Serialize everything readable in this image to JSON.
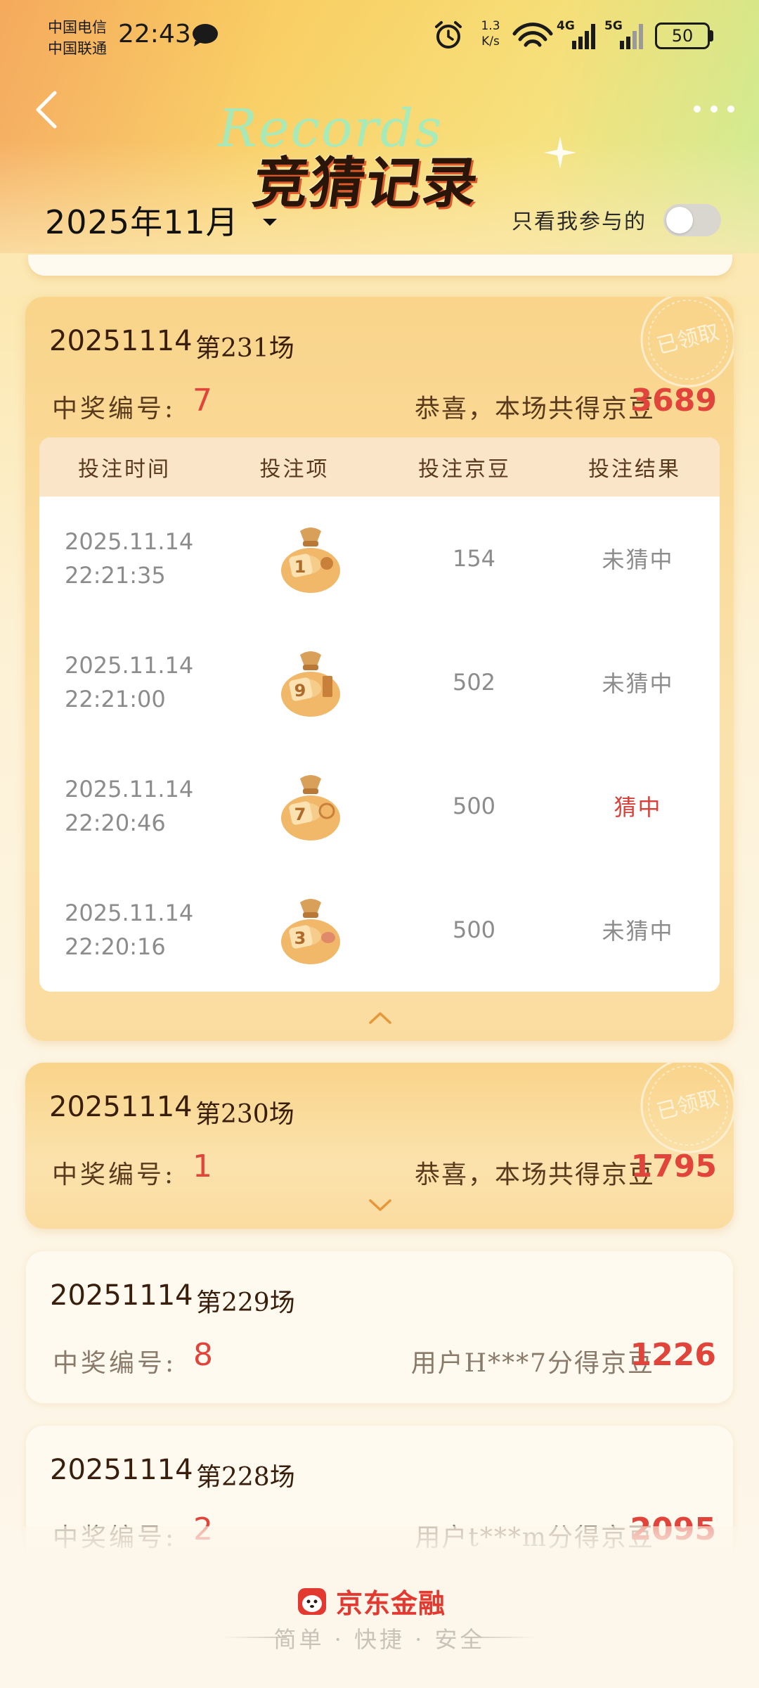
{
  "status_bar": {
    "carrier_1": "中国电信",
    "carrier_2": "中国联通",
    "time": "22:43",
    "net_speed_value": "1.3",
    "net_speed_unit": "K/s",
    "net_4g": "4G",
    "net_5g": "5G",
    "battery": "50"
  },
  "header": {
    "title": "竞猜记录",
    "title_watermark": "Records",
    "month": "2025年11月",
    "only_mine_label": "只看我参与的",
    "only_mine_on": false
  },
  "table_headers": [
    "投注时间",
    "投注项",
    "投注京豆",
    "投注结果"
  ],
  "stamp_text": "已领取",
  "prize_label": "中奖编号:",
  "records": [
    {
      "date": "20251114",
      "session": "第231场",
      "prize_number": "7",
      "result_text": "恭喜，本场共得京豆",
      "result_amount": "3689",
      "claimed": true,
      "expanded": true,
      "bets": [
        {
          "date": "2025.11.14",
          "time": "22:21:35",
          "item_number": "1",
          "amount": "154",
          "result": "未猜中"
        },
        {
          "date": "2025.11.14",
          "time": "22:21:00",
          "item_number": "9",
          "amount": "502",
          "result": "未猜中"
        },
        {
          "date": "2025.11.14",
          "time": "22:20:46",
          "item_number": "7",
          "amount": "500",
          "result": "猜中"
        },
        {
          "date": "2025.11.14",
          "time": "22:20:16",
          "item_number": "3",
          "amount": "500",
          "result": "未猜中"
        }
      ]
    },
    {
      "date": "20251114",
      "session": "第230场",
      "prize_number": "1",
      "result_text": "恭喜，本场共得京豆",
      "result_amount": "1795",
      "claimed": true,
      "expanded": false
    },
    {
      "date": "20251114",
      "session": "第229场",
      "prize_number": "8",
      "result_text": "用户H***7分得京豆",
      "result_amount": "1226",
      "claimed": false,
      "expanded": false
    },
    {
      "date": "20251114",
      "session": "第228场",
      "prize_number": "2",
      "result_text": "用户t***m分得京豆",
      "result_amount": "2095",
      "claimed": false,
      "expanded": false
    }
  ],
  "footer": {
    "brand": "京东金融",
    "slogan": "简单 · 快捷 · 安全"
  },
  "colors": {
    "accent_red": "#e0443a",
    "card_gold": "#f9d48a",
    "brand_red": "#e23a30"
  }
}
